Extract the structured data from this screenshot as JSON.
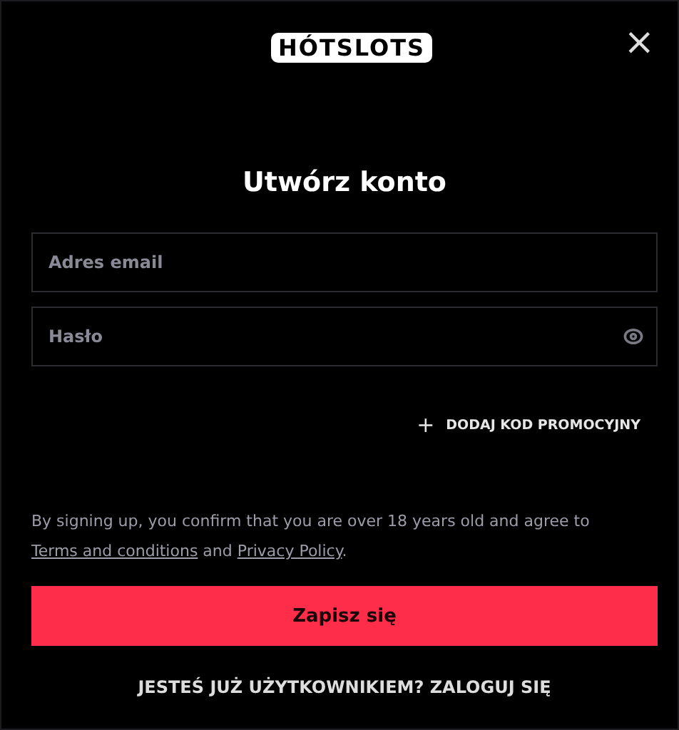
{
  "logo": "HÓTSLOTS",
  "close": "×",
  "title": "Utwórz konto",
  "fields": [
    {
      "kind": "email",
      "placeholder": "Adres email"
    },
    {
      "kind": "password",
      "placeholder": "Hasło"
    }
  ],
  "promo": {
    "icon": "+",
    "label": "DODAJ KOD PROMOCYJNY"
  },
  "legal": {
    "before": "By signing up, you confirm that you are over 18 years old and agree to",
    "terms": "Terms and conditions",
    "middle": "and",
    "privacy": "Privacy Policy",
    "after": "."
  },
  "submit": "Zapisz się",
  "login": "JESTEŚ JUŻ UŻYTKOWNIKIEM? ZALOGUJ SIĘ"
}
